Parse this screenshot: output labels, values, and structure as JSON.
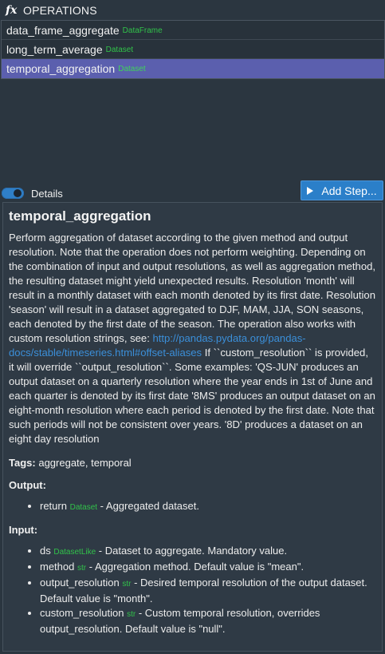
{
  "header": {
    "icon": "fx-icon",
    "title": "OPERATIONS"
  },
  "operations": [
    {
      "name": "data_frame_aggregate",
      "type": "DataFrame",
      "selected": false
    },
    {
      "name": "long_term_average",
      "type": "Dataset",
      "selected": false
    },
    {
      "name": "temporal_aggregation",
      "type": "Dataset",
      "selected": true
    }
  ],
  "details_toggle": {
    "label": "Details",
    "on": true
  },
  "add_step": {
    "label": "Add Step..."
  },
  "details": {
    "title": "temporal_aggregation",
    "description_before_link": "Perform aggregation of dataset according to the given method and output resolution. Note that the operation does not perform weighting. Depending on the combination of input and output resolutions, as well as aggregation method, the resulting dataset might yield unexpected results. Resolution 'month' will result in a monthly dataset with each month denoted by its first date. Resolution 'season' will result in a dataset aggregated to DJF, MAM, JJA, SON seasons, each denoted by the first date of the season. The operation also works with custom resolution strings, see: ",
    "link": "http://pandas.pydata.org/pandas-docs/stable/timeseries.html#offset-aliases",
    "description_after_link": " If ``custom_resolution`` is provided, it will override ``output_resolution``. Some examples: 'QS-JUN' produces an output dataset on a quarterly resolution where the year ends in 1st of June and each quarter is denoted by its first date '8MS' produces an output dataset on an eight-month resolution where each period is denoted by the first date. Note that such periods will not be consistent over years. '8D' produces a dataset on an eight day resolution",
    "tags_label": "Tags:",
    "tags": "aggregate, temporal",
    "output_label": "Output:",
    "output": {
      "name": "return",
      "type": "Dataset",
      "desc": " - Aggregated dataset."
    },
    "input_label": "Input:",
    "inputs": [
      {
        "name": "ds",
        "type": "DatasetLike",
        "desc": " - Dataset to aggregate. Mandatory value."
      },
      {
        "name": "method",
        "type": "str",
        "desc": " - Aggregation method. Default value is \"mean\"."
      },
      {
        "name": "output_resolution",
        "type": "str",
        "desc": " - Desired temporal resolution of the output dataset. Default value is \"month\"."
      },
      {
        "name": "custom_resolution",
        "type": "str",
        "desc": " - Custom temporal resolution, overrides output_resolution. Default value is \"null\"."
      }
    ]
  },
  "colors": {
    "background": "#2b3640",
    "selected": "#5b5fae",
    "type_green": "#31c24a",
    "accent_blue": "#2b7fc9",
    "link": "#3b8fd9"
  }
}
